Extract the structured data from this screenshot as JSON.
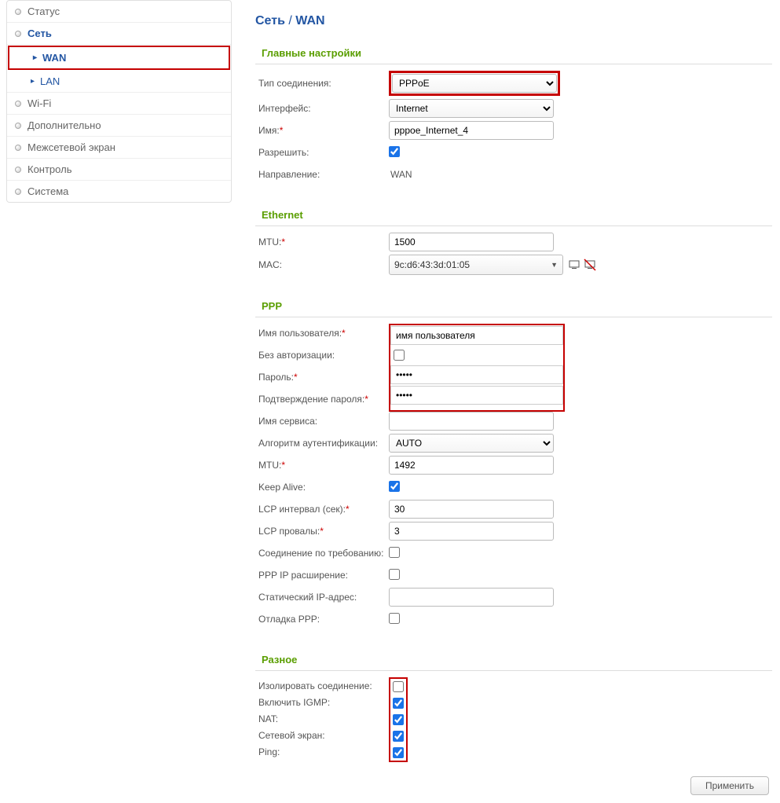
{
  "sidebar": {
    "items": [
      {
        "label": "Статус",
        "type": "top"
      },
      {
        "label": "Сеть",
        "type": "active"
      },
      {
        "label": "WAN",
        "type": "sub-highlight"
      },
      {
        "label": "LAN",
        "type": "sub"
      },
      {
        "label": "Wi-Fi",
        "type": "top"
      },
      {
        "label": "Дополнительно",
        "type": "top"
      },
      {
        "label": "Межсетевой экран",
        "type": "top"
      },
      {
        "label": "Контроль",
        "type": "top"
      },
      {
        "label": "Система",
        "type": "top"
      }
    ]
  },
  "breadcrumb": {
    "part1": "Сеть",
    "sep": "/",
    "part2": "WAN"
  },
  "sections": {
    "main": {
      "title": "Главные настройки",
      "connection_type_label": "Тип соединения:",
      "connection_type_value": "PPPoE",
      "interface_label": "Интерфейс:",
      "interface_value": "Internet",
      "name_label": "Имя:",
      "name_value": "pppoe_Internet_4",
      "allow_label": "Разрешить:",
      "allow_checked": true,
      "direction_label": "Направление:",
      "direction_value": "WAN"
    },
    "ethernet": {
      "title": "Ethernet",
      "mtu_label": "MTU:",
      "mtu_value": "1500",
      "mac_label": "MAC:",
      "mac_value": "9c:d6:43:3d:01:05"
    },
    "ppp": {
      "title": "PPP",
      "username_label": "Имя пользователя:",
      "username_value": "имя пользователя",
      "noauth_label": "Без авторизации:",
      "noauth_checked": false,
      "password_label": "Пароль:",
      "password_value": "•••••",
      "password_confirm_label": "Подтверждение пароля:",
      "password_confirm_value": "•••••",
      "service_label": "Имя сервиса:",
      "service_value": "",
      "auth_algo_label": "Алгоритм аутентификации:",
      "auth_algo_value": "AUTO",
      "mtu_label": "MTU:",
      "mtu_value": "1492",
      "keepalive_label": "Keep Alive:",
      "keepalive_checked": true,
      "lcp_interval_label": "LCP интервал (сек):",
      "lcp_interval_value": "30",
      "lcp_fails_label": "LCP провалы:",
      "lcp_fails_value": "3",
      "ondemand_label": "Соединение по требованию:",
      "ondemand_checked": false,
      "pppip_label": "PPP IP расширение:",
      "pppip_checked": false,
      "staticip_label": "Статический IP-адрес:",
      "staticip_value": "",
      "debug_label": "Отладка PPP:",
      "debug_checked": false
    },
    "misc": {
      "title": "Разное",
      "isolate_label": "Изолировать соединение:",
      "isolate_checked": false,
      "igmp_label": "Включить IGMP:",
      "igmp_checked": true,
      "nat_label": "NAT:",
      "nat_checked": true,
      "firewall_label": "Сетевой экран:",
      "firewall_checked": true,
      "ping_label": "Ping:",
      "ping_checked": true
    }
  },
  "footer": {
    "apply": "Применить"
  }
}
